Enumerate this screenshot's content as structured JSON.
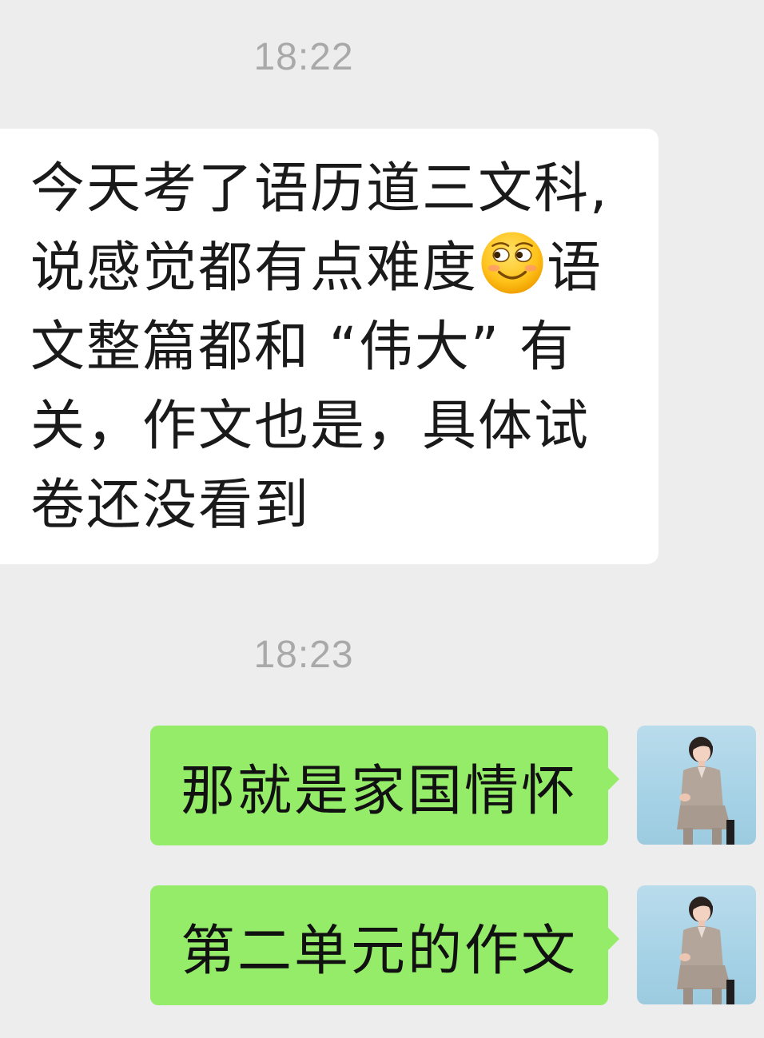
{
  "chat": {
    "messages": [
      {
        "type": "timestamp",
        "text": "18:22"
      },
      {
        "type": "incoming",
        "lines": [
          "今天考了语历道三文科,",
          "说感觉都有点难度",
          "语",
          "文整篇都和 “伟大” 有",
          "关，作文也是，具体试",
          "卷还没看到"
        ],
        "emoji": "grinning-face-emoji"
      },
      {
        "type": "timestamp",
        "text": "18:23"
      },
      {
        "type": "outgoing",
        "text": "那就是家国情怀"
      },
      {
        "type": "outgoing",
        "text": "第二单元的作文"
      }
    ]
  },
  "colors": {
    "background": "#ededed",
    "incoming_bubble": "#ffffff",
    "outgoing_bubble": "#95ec69",
    "timestamp_text": "#a9a9a9"
  }
}
